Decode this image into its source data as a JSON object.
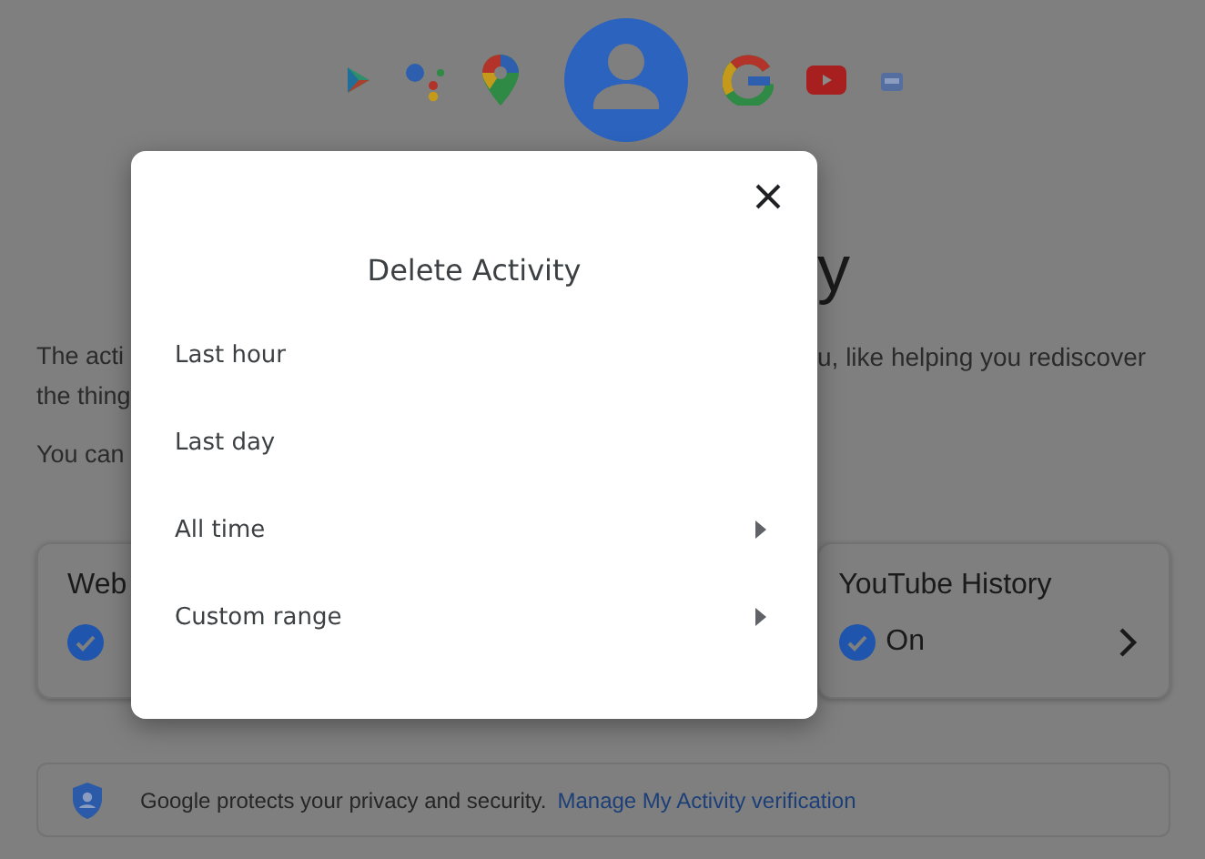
{
  "background": {
    "heading": "y",
    "paragraph_lines": [
      {
        "left": "The acti",
        "right": "u, like helping you rediscover"
      },
      {
        "left": "the thing"
      },
      {
        "left": "You can"
      }
    ],
    "cards": [
      {
        "title": "Web",
        "checked": true
      },
      {
        "title": "YouTube History",
        "status": "On",
        "checked": true
      }
    ],
    "banner": {
      "text": "Google protects your privacy and security.",
      "link": "Manage My Activity verification"
    }
  },
  "dialog": {
    "title": "Delete Activity",
    "items": [
      {
        "label": "Last hour",
        "kind": "plain"
      },
      {
        "label": "Last day",
        "kind": "plain"
      },
      {
        "label": "All time",
        "kind": "submenu"
      },
      {
        "label": "Custom range",
        "kind": "submenu"
      }
    ]
  }
}
